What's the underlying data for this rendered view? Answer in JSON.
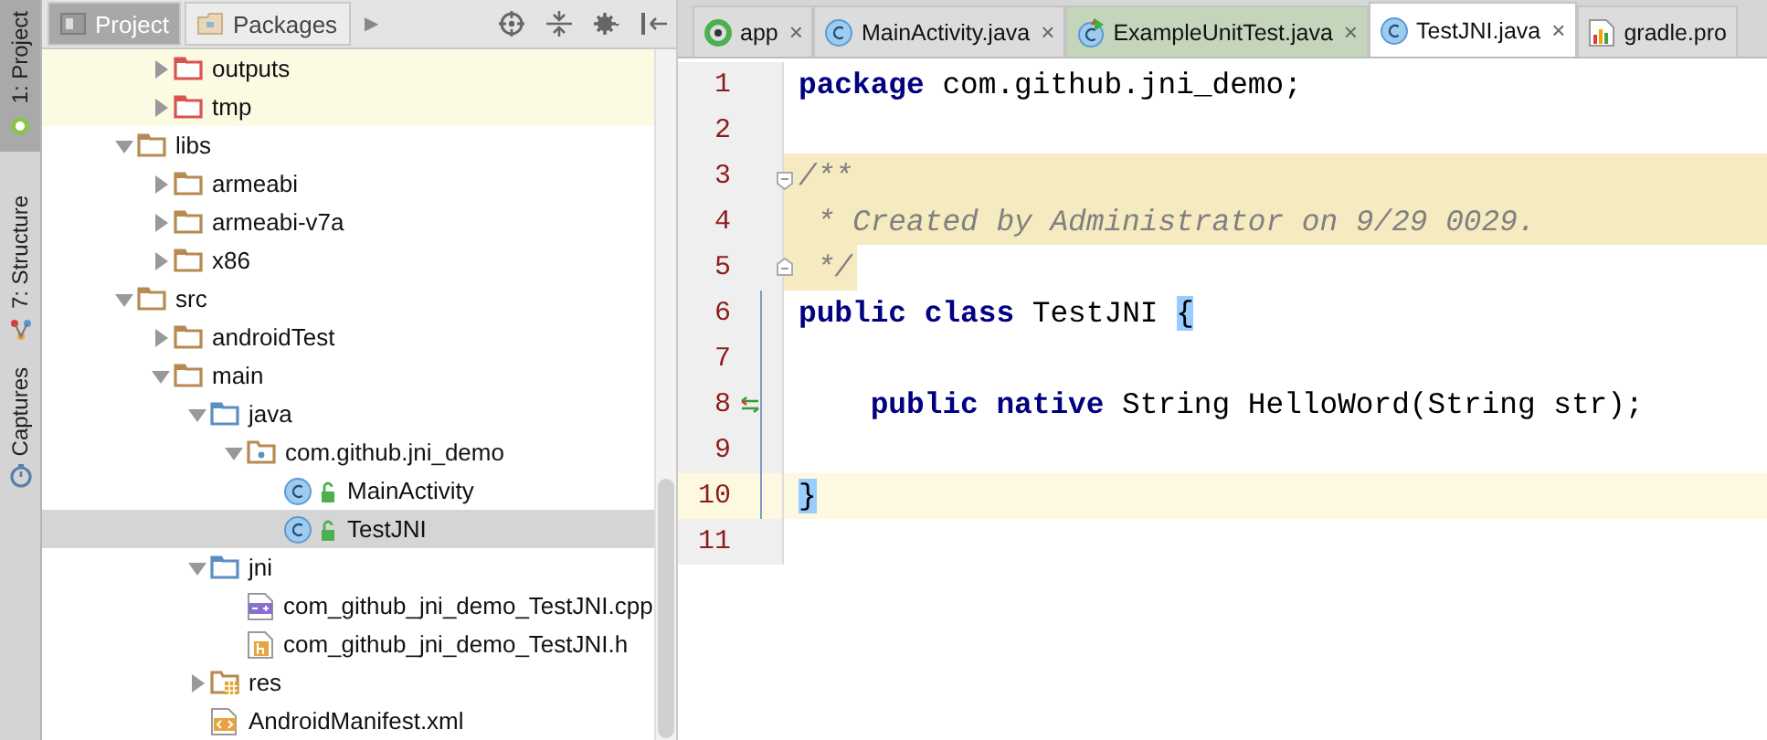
{
  "tool_strip": [
    {
      "label": "1: Project",
      "kind": "project",
      "selected": true
    },
    {
      "label": "7: Structure",
      "kind": "structure",
      "selected": false
    },
    {
      "label": "Captures",
      "kind": "captures",
      "selected": false
    }
  ],
  "project_panel": {
    "tabs": [
      {
        "label": "Project",
        "selected": true
      },
      {
        "label": "Packages",
        "selected": false
      }
    ],
    "more_tabs": "▶",
    "tree": {
      "cut_branch": [
        {
          "label": "outputs",
          "kind": "folder-excluded",
          "expanded": false,
          "highlighted": true,
          "selected": false
        },
        {
          "label": "tmp",
          "kind": "folder-excluded",
          "expanded": false,
          "highlighted": true,
          "selected": false
        }
      ],
      "items": [
        {
          "label": "libs",
          "kind": "folder",
          "expanded": true,
          "highlighted": false,
          "selected": false,
          "children": [
            {
              "label": "armeabi",
              "kind": "folder",
              "expanded": false,
              "highlighted": false,
              "selected": false
            },
            {
              "label": "armeabi-v7a",
              "kind": "folder",
              "expanded": false,
              "highlighted": false,
              "selected": false
            },
            {
              "label": "x86",
              "kind": "folder",
              "expanded": false,
              "highlighted": false,
              "selected": false
            }
          ]
        },
        {
          "label": "src",
          "kind": "folder",
          "expanded": true,
          "highlighted": false,
          "selected": false,
          "children": [
            {
              "label": "androidTest",
              "kind": "folder",
              "expanded": false,
              "highlighted": false,
              "selected": false
            },
            {
              "label": "main",
              "kind": "folder",
              "expanded": true,
              "highlighted": false,
              "selected": false,
              "children": [
                {
                  "label": "java",
                  "kind": "folder-source",
                  "expanded": true,
                  "highlighted": false,
                  "selected": false,
                  "children": [
                    {
                      "label": "com.github.jni_demo",
                      "kind": "package",
                      "expanded": true,
                      "highlighted": false,
                      "selected": false,
                      "children": [
                        {
                          "label": "MainActivity",
                          "kind": "class",
                          "highlighted": false,
                          "selected": false
                        },
                        {
                          "label": "TestJNI",
                          "kind": "class",
                          "highlighted": false,
                          "selected": true
                        }
                      ]
                    }
                  ]
                },
                {
                  "label": "jni",
                  "kind": "folder-source",
                  "expanded": true,
                  "highlighted": false,
                  "selected": false,
                  "children": [
                    {
                      "label": "com_github_jni_demo_TestJNI.cpp",
                      "kind": "cpp",
                      "highlighted": false,
                      "selected": false
                    },
                    {
                      "label": "com_github_jni_demo_TestJNI.h",
                      "kind": "header",
                      "highlighted": false,
                      "selected": false
                    }
                  ]
                },
                {
                  "label": "res",
                  "kind": "folder-res",
                  "expanded": false,
                  "highlighted": false,
                  "selected": false
                },
                {
                  "label": "AndroidManifest.xml",
                  "kind": "manifest",
                  "highlighted": false,
                  "selected": false
                }
              ]
            }
          ]
        }
      ]
    }
  },
  "editor": {
    "tabs": [
      {
        "label": "app",
        "kind": "module",
        "selected": false,
        "close": "×"
      },
      {
        "label": "MainActivity.java",
        "kind": "class",
        "selected": false,
        "close": "×"
      },
      {
        "label": "ExampleUnitTest.java",
        "kind": "test",
        "selected": false,
        "close": "×"
      },
      {
        "label": "TestJNI.java",
        "kind": "class",
        "selected": true,
        "close": "×"
      },
      {
        "label": "gradle.pro",
        "kind": "gradle",
        "selected": false
      }
    ],
    "lines": [
      {
        "number": "1",
        "tokens": [
          {
            "text": "package",
            "kind": "keyword"
          },
          {
            "text": " com.github.jni_demo;",
            "kind": "plain"
          }
        ]
      },
      {
        "number": "2"
      },
      {
        "number": "3",
        "doc_comment": true,
        "fold_start": true,
        "tokens": [
          {
            "text": "/**",
            "kind": "comment"
          }
        ]
      },
      {
        "number": "4",
        "doc_comment": true,
        "tokens": [
          {
            "text": " * Created by Administrator on 9/29 0029.",
            "kind": "comment"
          }
        ]
      },
      {
        "number": "5",
        "doc_comment": true,
        "fold_end": true,
        "tokens": [
          {
            "text": " */",
            "kind": "comment"
          }
        ]
      },
      {
        "number": "6",
        "scope": true,
        "tokens": [
          {
            "text": "public class",
            "kind": "keyword"
          },
          {
            "text": " TestJNI ",
            "kind": "plain"
          },
          {
            "text": "{",
            "kind": "brace"
          }
        ]
      },
      {
        "number": "7",
        "scope": true
      },
      {
        "number": "8",
        "scope": true,
        "implements_marker": true,
        "tokens": [
          {
            "text": "    public native",
            "kind": "keyword"
          },
          {
            "text": " String HelloWord(String str);",
            "kind": "plain"
          }
        ]
      },
      {
        "number": "9",
        "scope": true
      },
      {
        "number": "10",
        "scope": true,
        "current_line": true,
        "tokens": [
          {
            "text": "}",
            "kind": "brace"
          }
        ]
      },
      {
        "number": "11"
      }
    ]
  }
}
